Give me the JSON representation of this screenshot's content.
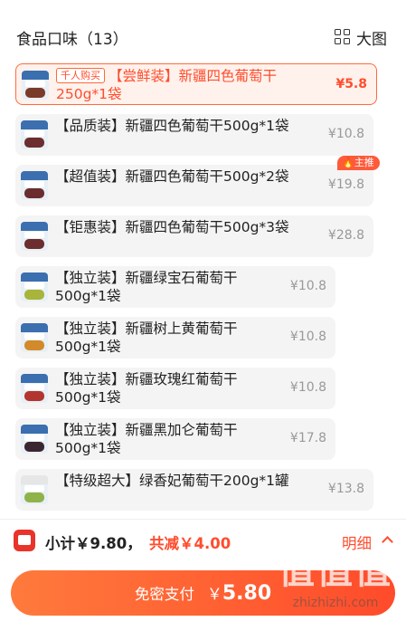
{
  "header": {
    "title": "食品口味（13）",
    "view_toggle_label": "大图"
  },
  "items": [
    {
      "tag": "千人购买",
      "name": "【尝鲜装】新疆四色葡萄干250g*1袋",
      "price": "¥5.8",
      "selected": true,
      "fruit_color": "#7a3b2a"
    },
    {
      "name": "【品质装】新疆四色葡萄干500g*1袋",
      "price": "¥10.8",
      "fruit_color": "#6b2d2d"
    },
    {
      "name": "【超值装】新疆四色葡萄干500g*2袋",
      "price": "¥19.8",
      "fruit_color": "#6b2d2d",
      "badge": "主推"
    },
    {
      "name": "【钜惠装】新疆四色葡萄干500g*3袋",
      "price": "¥28.8",
      "fruit_color": "#6b2d2d"
    },
    {
      "name": "【独立装】新疆绿宝石葡萄干500g*1袋",
      "price": "¥10.8",
      "fruit_color": "#a8b43a"
    },
    {
      "name": "【独立装】新疆树上黄葡萄干500g*1袋",
      "price": "¥10.8",
      "fruit_color": "#d28a2a"
    },
    {
      "name": "【独立装】新疆玫瑰红葡萄干500g*1袋",
      "price": "¥10.8",
      "fruit_color": "#b3352f"
    },
    {
      "name": "【独立装】新疆黑加仑葡萄干500g*1袋",
      "price": "¥17.8",
      "fruit_color": "#3a2530"
    },
    {
      "name": "【特级超大】绿香妃葡萄干200g*1罐",
      "price": "¥13.8",
      "fruit_color": "#8fb34a"
    }
  ],
  "summary": {
    "subtotal": "小计￥9.80，",
    "discount": "共减￥4.00",
    "detail_label": "明细"
  },
  "pay": {
    "label": "免密支付",
    "currency": "￥",
    "amount": "5.80"
  },
  "watermark": {
    "big": "值值值",
    "small": "zhizhizhi.com"
  },
  "colors": {
    "accent": "#ff4d2e",
    "selected_bg": "#fff2ec"
  }
}
